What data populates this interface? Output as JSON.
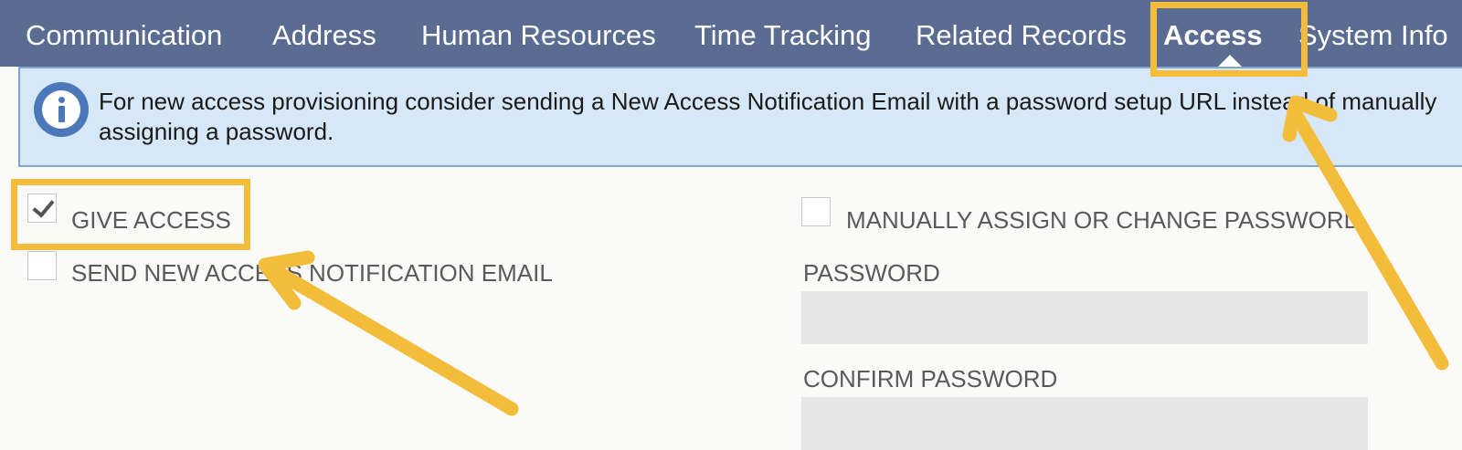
{
  "tabs": [
    {
      "label": "Communication",
      "active": false
    },
    {
      "label": "Address",
      "active": false
    },
    {
      "label": "Human Resources",
      "active": false
    },
    {
      "label": "Time Tracking",
      "active": false
    },
    {
      "label": "Related Records",
      "active": false
    },
    {
      "label": "Access",
      "active": true
    },
    {
      "label": "System Info",
      "active": false
    }
  ],
  "banner": {
    "icon": "info-icon",
    "message": "For new access provisioning consider sending a New Access Notification Email with a password setup URL instead of manually assigning a password."
  },
  "form": {
    "give_access": {
      "label": "GIVE ACCESS",
      "checked": true
    },
    "send_notification": {
      "label": "SEND NEW ACCESS NOTIFICATION EMAIL",
      "checked": false
    },
    "manual_password": {
      "label": "MANUALLY ASSIGN OR CHANGE PASSWORD",
      "checked": false
    },
    "password": {
      "label": "PASSWORD",
      "value": ""
    },
    "confirm_password": {
      "label": "CONFIRM PASSWORD",
      "value": ""
    }
  },
  "colors": {
    "tab_bar": "#5b6c92",
    "banner_bg": "#d6e8f7",
    "info_icon": "#4b78b8",
    "annotation": "#f3bc3a",
    "input_bg": "#e6e6e6"
  }
}
